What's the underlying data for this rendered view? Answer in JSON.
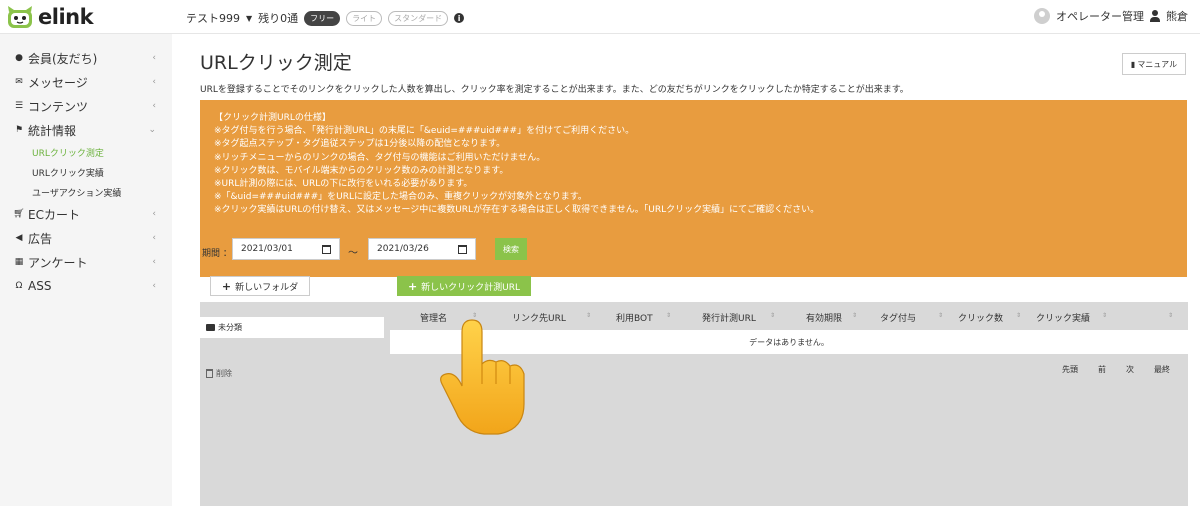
{
  "app": {
    "logo_text": "elink"
  },
  "header": {
    "account_name": "テスト999",
    "remaining": "残り0通",
    "plans": [
      "フリー",
      "ライト",
      "スタンダード"
    ],
    "active_plan": "フリー",
    "operator": "オペレーター管理",
    "user": "熊倉"
  },
  "sidebar": {
    "items": [
      {
        "label": "会員(友だち)",
        "icon": "user-icon"
      },
      {
        "label": "メッセージ",
        "icon": "envelope-icon"
      },
      {
        "label": "コンテンツ",
        "icon": "list-icon"
      },
      {
        "label": "統計情報",
        "icon": "flag-icon"
      },
      {
        "label": "ECカート",
        "icon": "cart-icon"
      },
      {
        "label": "広告",
        "icon": "bullhorn-icon"
      },
      {
        "label": "アンケート",
        "icon": "keyboard-icon"
      },
      {
        "label": "ASS",
        "icon": "headset-icon"
      }
    ],
    "subitems": [
      "URLクリック測定",
      "URLクリック実績",
      "ユーザアクション実績"
    ],
    "active_subitem": "URLクリック測定"
  },
  "page": {
    "title": "URLクリック測定",
    "manual_label": "マニュアル",
    "description": "URLを登録することでそのリンクをクリックした人数を算出し、クリック率を測定することが出来ます。また、どの友だちがリンクをクリックしたか特定することが出来ます。",
    "notice_lines": [
      "【クリック計測URLの仕様】",
      "※タグ付与を行う場合、「発行計測URL」の末尾に「&euid=###uid###」を付けてご利用ください。",
      "※タグ起点ステップ・タグ追従ステップは1分後以降の配信となります。",
      "※リッチメニューからのリンクの場合、タグ付与の機能はご利用いただけません。",
      "※クリック数は、モバイル端末からのクリック数のみの計測となります。",
      "※URL計測の際には、URLの下に改行をいれる必要があります。",
      "※「&uid=###uid###」をURLに設定した場合のみ、重複クリックが対象外となります。",
      "※クリック実績はURLの付け替え、又はメッセージ中に複数URLが存在する場合は正しく取得できません。「URLクリック実績」にてご確認ください。"
    ],
    "notice_color": "#e89c3f",
    "period_label": "期間 ：",
    "date_from": "2021/03/01",
    "date_to": "2021/03/26",
    "tilde": "〜",
    "search_label": "検索",
    "new_folder_label": "新しいフォルダ",
    "new_url_label": "新しいクリック計測URL",
    "folder_name": "未分類",
    "delete_label": "削除",
    "table_headers": [
      "管理名",
      "リンク先URL",
      "利用BOT",
      "発行計測URL",
      "有効期限",
      "タグ付与",
      "クリック数",
      "クリック実績"
    ],
    "empty_message": "データはありません。",
    "pager": [
      "先頭",
      "前",
      "次",
      "最終"
    ],
    "accent_color": "#8bc34a"
  }
}
